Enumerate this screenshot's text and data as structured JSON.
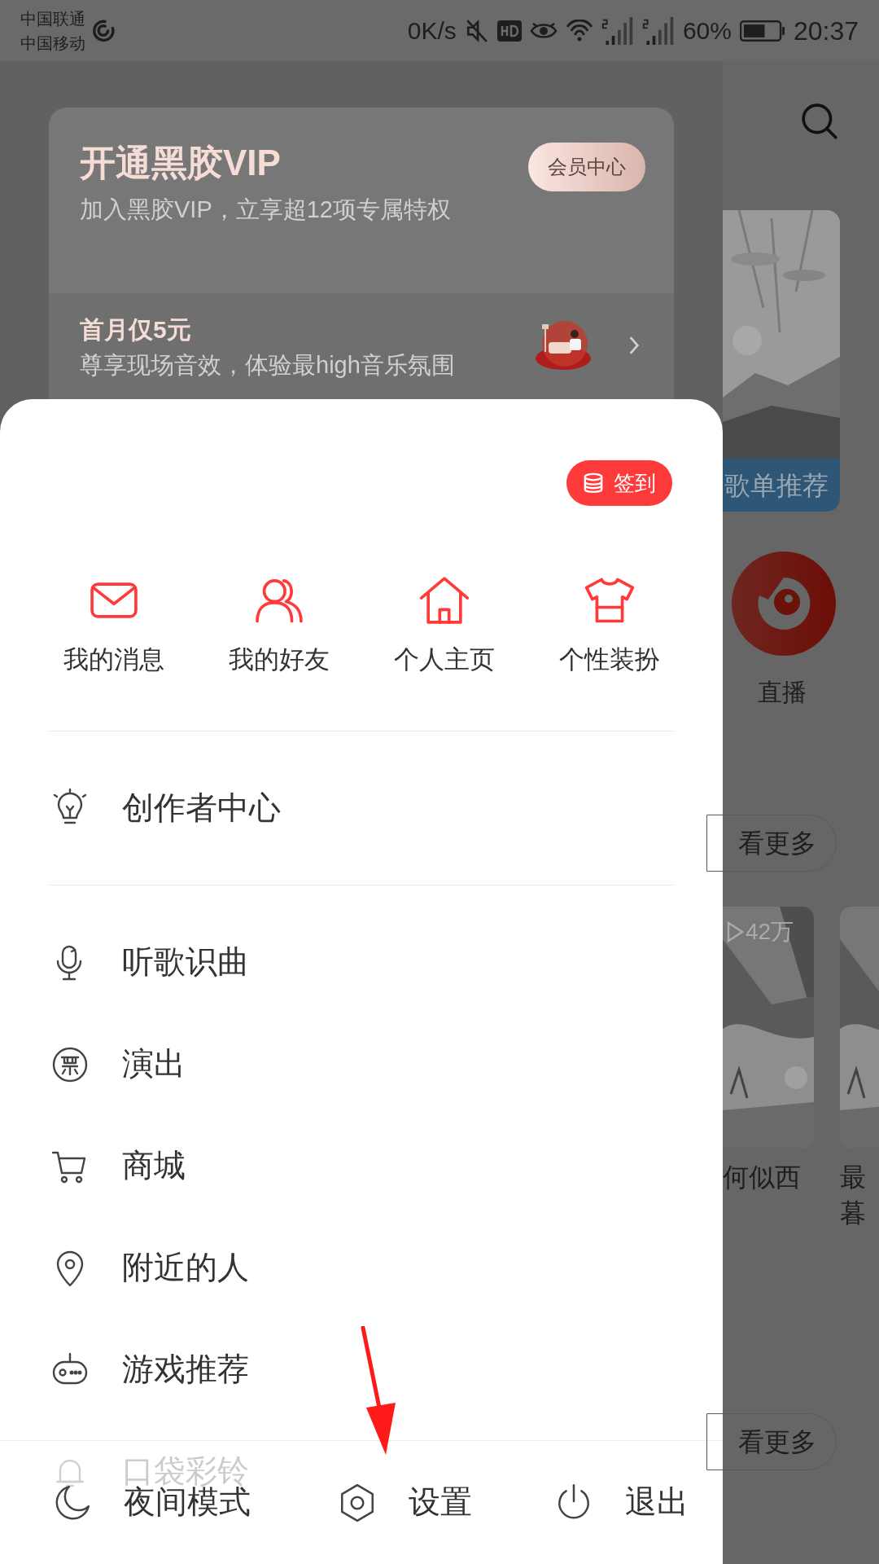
{
  "status_bar": {
    "carriers": [
      "中国联通",
      "中国移动"
    ],
    "speed": "0K/s",
    "battery": "60%",
    "time": "20:37"
  },
  "vip_card": {
    "title": "开通黑胶VIP",
    "subtitle": "加入黑胶VIP，立享超12项专属特权",
    "button": "会员中心",
    "offer_title": "首月仅5元",
    "offer_text": "尊享现场音效，体验最high音乐氛围"
  },
  "sign_in_button": "签到",
  "shortcuts": [
    {
      "label": "我的消息",
      "kind": "mail"
    },
    {
      "label": "我的好友",
      "kind": "friends"
    },
    {
      "label": "个人主页",
      "kind": "home"
    },
    {
      "label": "个性装扮",
      "kind": "shirt"
    }
  ],
  "menu_sections": [
    [
      {
        "label": "创作者中心",
        "kind": "bulb"
      }
    ],
    [
      {
        "label": "听歌识曲",
        "kind": "mic"
      },
      {
        "label": "演出",
        "kind": "ticket"
      },
      {
        "label": "商城",
        "kind": "cart"
      },
      {
        "label": "附近的人",
        "kind": "pin"
      },
      {
        "label": "游戏推荐",
        "kind": "gamepad"
      },
      {
        "label": "口袋彩铃",
        "kind": "bell"
      }
    ]
  ],
  "bottom_bar": [
    {
      "label": "夜间模式",
      "kind": "moon"
    },
    {
      "label": "设置",
      "kind": "gear"
    },
    {
      "label": "退出",
      "kind": "power"
    }
  ],
  "background": {
    "playlist_label": "歌单推荐",
    "live_label": "直播",
    "more_buttons": [
      "看更多",
      "看更多"
    ],
    "play_count": "42万",
    "captions": [
      [
        "何似西"
      ],
      [
        "最",
        "暮"
      ]
    ]
  }
}
